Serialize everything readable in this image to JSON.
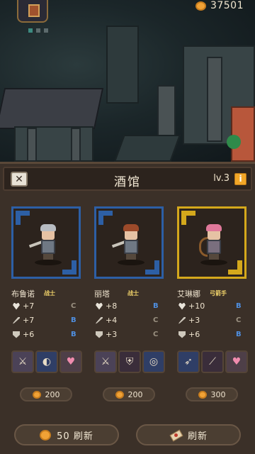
{
  "top_bar": {
    "coins": "37501"
  },
  "tavern": {
    "title": "酒馆",
    "level": "lv.3",
    "info_glyph": "i",
    "close_glyph": "✕"
  },
  "heroes": [
    {
      "name": "布鲁诺",
      "class": "战士",
      "frame": "blue",
      "stats": [
        {
          "icon": "heart-icon",
          "value": "+7",
          "grade": "C"
        },
        {
          "icon": "sword-icon",
          "value": "+7",
          "grade": "B"
        },
        {
          "icon": "shield-icon",
          "value": "+6",
          "grade": "B"
        }
      ],
      "skills": [
        "sword-slash-icon",
        "whirlwind-icon",
        "heart-icon"
      ],
      "price": "200"
    },
    {
      "name": "丽塔",
      "class": "战士",
      "frame": "blue",
      "stats": [
        {
          "icon": "heart-icon",
          "value": "+8",
          "grade": "B"
        },
        {
          "icon": "sword-icon",
          "value": "+4",
          "grade": "C"
        },
        {
          "icon": "shield-icon",
          "value": "+3",
          "grade": "C"
        }
      ],
      "skills": [
        "sword-slash-icon",
        "shield-icon",
        "target-icon"
      ],
      "price": "200"
    },
    {
      "name": "艾琳娜",
      "class": "弓箭手",
      "frame": "gold",
      "stats": [
        {
          "icon": "heart-icon",
          "value": "+10",
          "grade": "B"
        },
        {
          "icon": "sword-icon",
          "value": "+3",
          "grade": "C"
        },
        {
          "icon": "shield-icon",
          "value": "+6",
          "grade": "B"
        }
      ],
      "skills": [
        "arrow-icon",
        "spear-icon",
        "heart-icon"
      ],
      "price": "300"
    }
  ],
  "footer": {
    "refresh_cost_label": "50 刷新",
    "free_refresh_label": "刷新"
  },
  "colors": {
    "blue_frame": "#2d5fa5",
    "gold_frame": "#d4a81c",
    "grade_b": "#4f8fe0",
    "grade_c": "#9a9080",
    "coin": "#f0a236"
  }
}
